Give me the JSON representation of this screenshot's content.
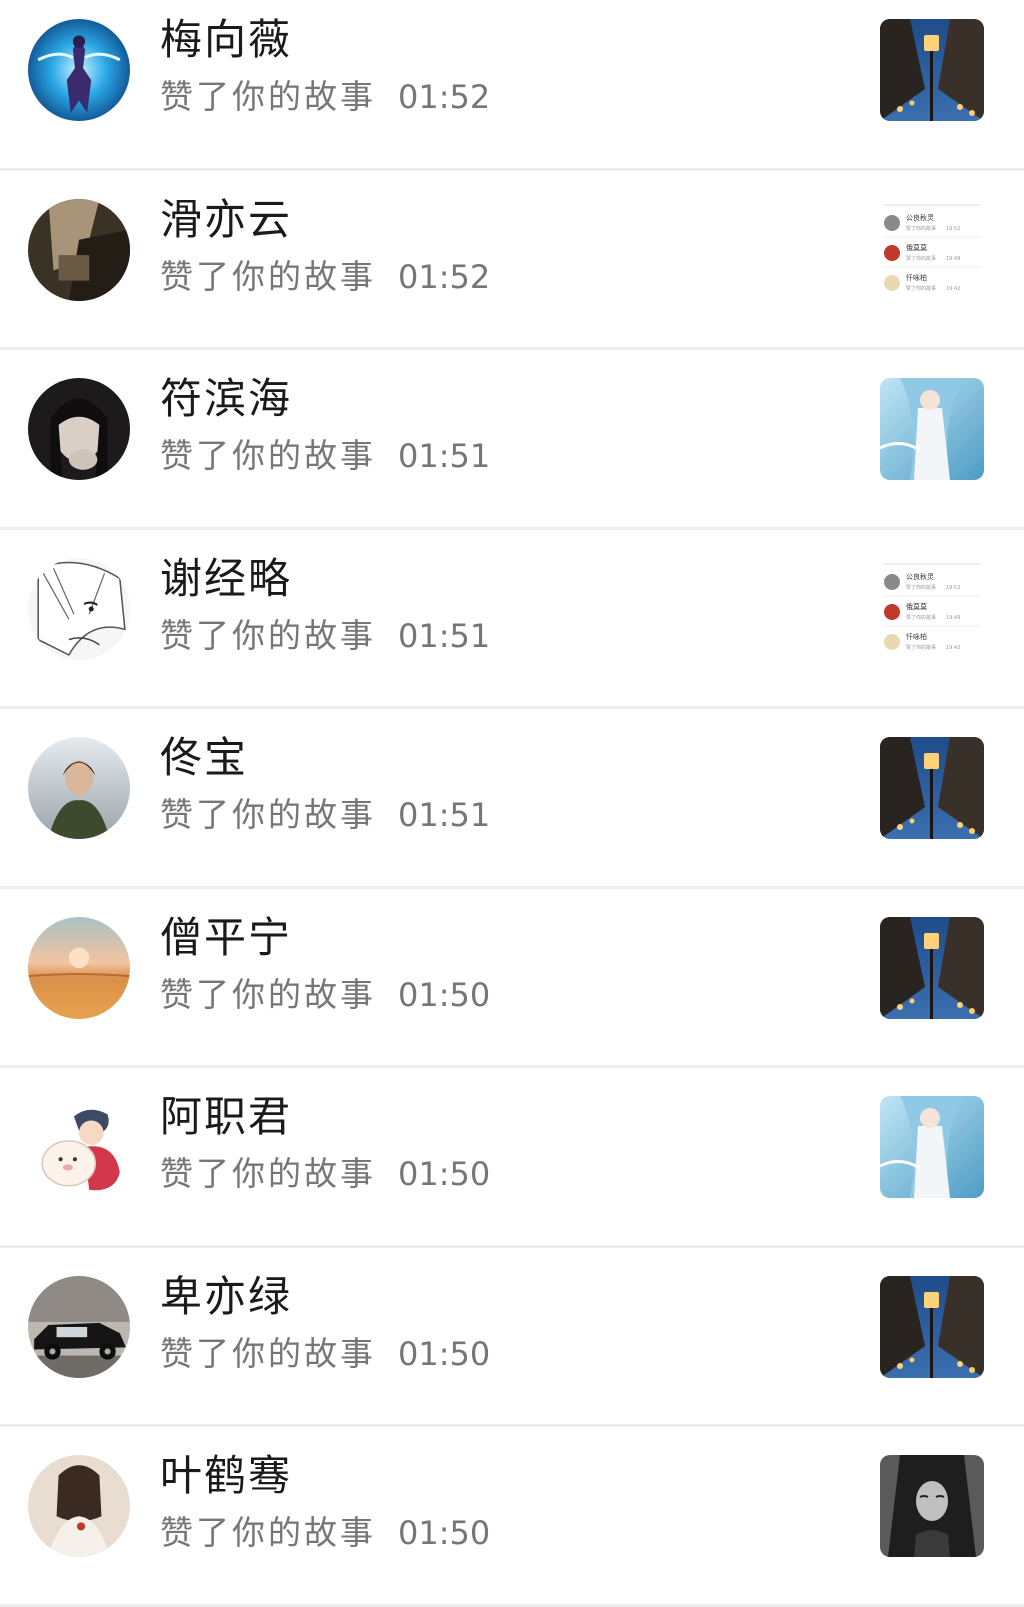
{
  "notifications": [
    {
      "name": "梅向薇",
      "action": "赞了你的故事",
      "time": "01:52",
      "avatar": "fantasy-warrior-avatar",
      "thumb": "street-lamp-night-thumb"
    },
    {
      "name": "滑亦云",
      "action": "赞了你的故事",
      "time": "01:52",
      "avatar": "dark-portrait-avatar",
      "thumb": "likes-list-screenshot-thumb"
    },
    {
      "name": "符滨海",
      "action": "赞了你的故事",
      "time": "01:51",
      "avatar": "girl-hand-on-chin-avatar",
      "thumb": "anime-girl-sea-thumb"
    },
    {
      "name": "谢经略",
      "action": "赞了你的故事",
      "time": "01:51",
      "avatar": "manga-sketch-avatar",
      "thumb": "likes-list-screenshot-thumb"
    },
    {
      "name": "佟宝",
      "action": "赞了你的故事",
      "time": "01:51",
      "avatar": "woman-green-coat-avatar",
      "thumb": "street-lamp-night-thumb"
    },
    {
      "name": "僧平宁",
      "action": "赞了你的故事",
      "time": "01:50",
      "avatar": "beach-sunset-avatar",
      "thumb": "street-lamp-night-thumb"
    },
    {
      "name": "阿职君",
      "action": "赞了你的故事",
      "time": "01:50",
      "avatar": "cartoon-boy-plush-avatar",
      "thumb": "anime-girl-sea-thumb"
    },
    {
      "name": "卑亦绿",
      "action": "赞了你的故事",
      "time": "01:50",
      "avatar": "vintage-car-avatar",
      "thumb": "street-lamp-night-thumb"
    },
    {
      "name": "叶鹤骞",
      "action": "赞了你的故事",
      "time": "01:50",
      "avatar": "woman-back-hair-avatar",
      "thumb": "gothic-woman-thumb"
    }
  ],
  "mini_list": {
    "rows": [
      {
        "name": "公良秋灵",
        "text": "赞了你的故事",
        "time": "19:52"
      },
      {
        "name": "俄莫莫",
        "text": "赞了你的故事",
        "time": "19:49"
      },
      {
        "name": "忏咏柏",
        "text": "赞了你的故事",
        "time": "19:42"
      }
    ]
  },
  "colors": {
    "name": "#1a1a1a",
    "subtext": "#767676",
    "divider": "#eeeeee"
  }
}
